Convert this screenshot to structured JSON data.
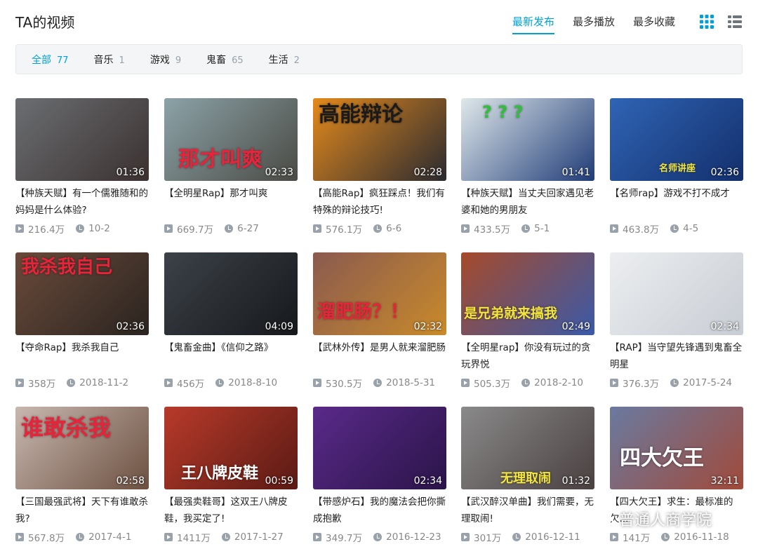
{
  "page_title": "TA的视频",
  "sort_tabs": [
    {
      "label": "最新发布",
      "active": true
    },
    {
      "label": "最多播放",
      "active": false
    },
    {
      "label": "最多收藏",
      "active": false
    }
  ],
  "view_modes": [
    "grid-view-icon",
    "list-view-icon"
  ],
  "accent_color": "#00a1d6",
  "filters": [
    {
      "label": "全部",
      "count": "77",
      "active": true
    },
    {
      "label": "音乐",
      "count": "1",
      "active": false
    },
    {
      "label": "游戏",
      "count": "9",
      "active": false
    },
    {
      "label": "鬼畜",
      "count": "65",
      "active": false
    },
    {
      "label": "生活",
      "count": "2",
      "active": false
    }
  ],
  "videos": [
    {
      "title": "【种族天赋】有一个儒雅随和的妈妈是什么体验?",
      "duration": "01:36",
      "plays": "216.4万",
      "date": "10-2",
      "colors": [
        "#6b6e72",
        "#3b3130"
      ],
      "overlay": ""
    },
    {
      "title": "【全明星Rap】那才叫爽",
      "duration": "02:33",
      "plays": "669.7万",
      "date": "6-27",
      "colors": [
        "#8ca3a8",
        "#4a4a44"
      ],
      "overlay": "那才叫爽"
    },
    {
      "title": "【高能Rap】疯狂踩点！我们有特殊的辩论技巧!",
      "duration": "02:28",
      "plays": "576.1万",
      "date": "6-6",
      "colors": [
        "#e58a1c",
        "#2a2a30"
      ],
      "overlay": "高能辩论"
    },
    {
      "title": "【种族天赋】当丈夫回家遇见老婆和她的男朋友",
      "duration": "01:41",
      "plays": "433.5万",
      "date": "5-1",
      "colors": [
        "#dfe8ea",
        "#203c78"
      ],
      "overlay": "? ? ?"
    },
    {
      "title": "【名师rap】游戏不打不成才",
      "duration": "02:36",
      "plays": "463.8万",
      "date": "4-5",
      "colors": [
        "#2f64b5",
        "#132f6c"
      ],
      "overlay": "名师讲座"
    },
    {
      "title": "【夺命Rap】我杀我自己",
      "duration": "02:36",
      "plays": "358万",
      "date": "2018-11-2",
      "colors": [
        "#6a4a3a",
        "#2a2420"
      ],
      "overlay": "我杀我自己"
    },
    {
      "title": "【鬼畜金曲】《信仰之路》",
      "duration": "04:09",
      "plays": "456万",
      "date": "2018-8-10",
      "colors": [
        "#3c4248",
        "#16181c"
      ],
      "overlay": ""
    },
    {
      "title": "【武林外传】是男人就来溜肥肠",
      "duration": "02:32",
      "plays": "530.5万",
      "date": "2018-5-31",
      "colors": [
        "#8a5a50",
        "#c98a2a"
      ],
      "overlay": "溜肥肠？！"
    },
    {
      "title": "【全明星rap】你没有玩过的贪玩界悦",
      "duration": "02:49",
      "plays": "505.3万",
      "date": "2018-2-10",
      "colors": [
        "#a64a2a",
        "#3a5aa8"
      ],
      "overlay": "是兄弟就来搞我"
    },
    {
      "title": "【RAP】当守望先锋遇到鬼畜全明星",
      "duration": "02:34",
      "plays": "376.3万",
      "date": "2017-5-24",
      "colors": [
        "#eceef0",
        "#c8cdd4"
      ],
      "overlay": ""
    },
    {
      "title": "【三国最强武将】天下有谁敢杀我?",
      "duration": "02:58",
      "plays": "567.8万",
      "date": "2017-4-1",
      "colors": [
        "#c9b8b0",
        "#6b5040"
      ],
      "overlay": "谁敢杀我"
    },
    {
      "title": "【最强卖鞋哥】这双王八牌皮鞋，我买定了!",
      "duration": "00:59",
      "plays": "1411万",
      "date": "2017-1-27",
      "colors": [
        "#b83a2a",
        "#5a1a14"
      ],
      "overlay": "王八牌皮鞋"
    },
    {
      "title": "【带感炉石】我的魔法会把你撕成抱歉",
      "duration": "02:34",
      "plays": "349.7万",
      "date": "2016-12-23",
      "colors": [
        "#5a2a8a",
        "#2a1448"
      ],
      "overlay": ""
    },
    {
      "title": "【武汉醉汉单曲】我们需要，无理取闹!",
      "duration": "01:32",
      "plays": "301万",
      "date": "2016-12-11",
      "colors": [
        "#8a8a8a",
        "#4a4040"
      ],
      "overlay": "无理取闹"
    },
    {
      "title": "【四大欠王】求生：最标准的欠...",
      "duration": "32:11",
      "plays": "141万",
      "date": "2016-11-18",
      "colors": [
        "#6a7aa0",
        "#a04a3a"
      ],
      "overlay": "四大欠王"
    }
  ],
  "watermark": "普通人商学院"
}
